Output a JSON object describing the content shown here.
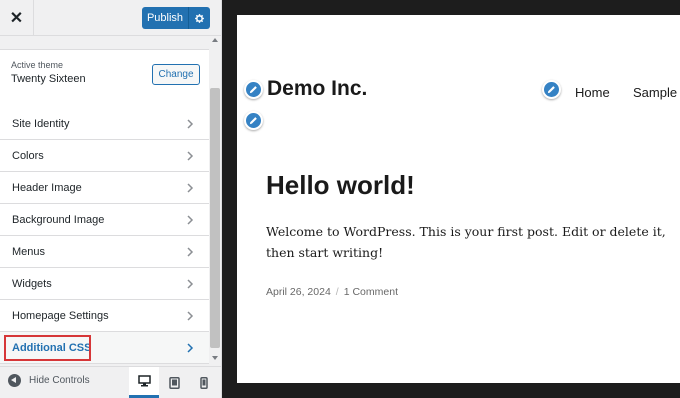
{
  "topbar": {
    "close_glyph": "✕",
    "publish_label": "Publish"
  },
  "theme": {
    "active_label": "Active theme",
    "name": "Twenty Sixteen",
    "change_label": "Change"
  },
  "menu": {
    "items": [
      {
        "label": "Site Identity"
      },
      {
        "label": "Colors"
      },
      {
        "label": "Header Image"
      },
      {
        "label": "Background Image"
      },
      {
        "label": "Menus"
      },
      {
        "label": "Widgets"
      },
      {
        "label": "Homepage Settings"
      },
      {
        "label": "Additional CSS"
      }
    ],
    "active_index": 7
  },
  "footer": {
    "hide_controls_label": "Hide Controls",
    "active_device": "desktop"
  },
  "preview": {
    "site_title": "Demo Inc.",
    "nav": {
      "home": "Home",
      "sample": "Sample"
    },
    "post_title": "Hello world!",
    "post_body": "Welcome to WordPress. This is your first post. Edit or delete it, then start writing!",
    "post_date": "April 26, 2024",
    "meta_separator": "/",
    "post_comments": "1 Comment"
  },
  "colors": {
    "accent": "#2271b1",
    "highlight_border": "#d63638",
    "pencil": "#3582c4"
  }
}
